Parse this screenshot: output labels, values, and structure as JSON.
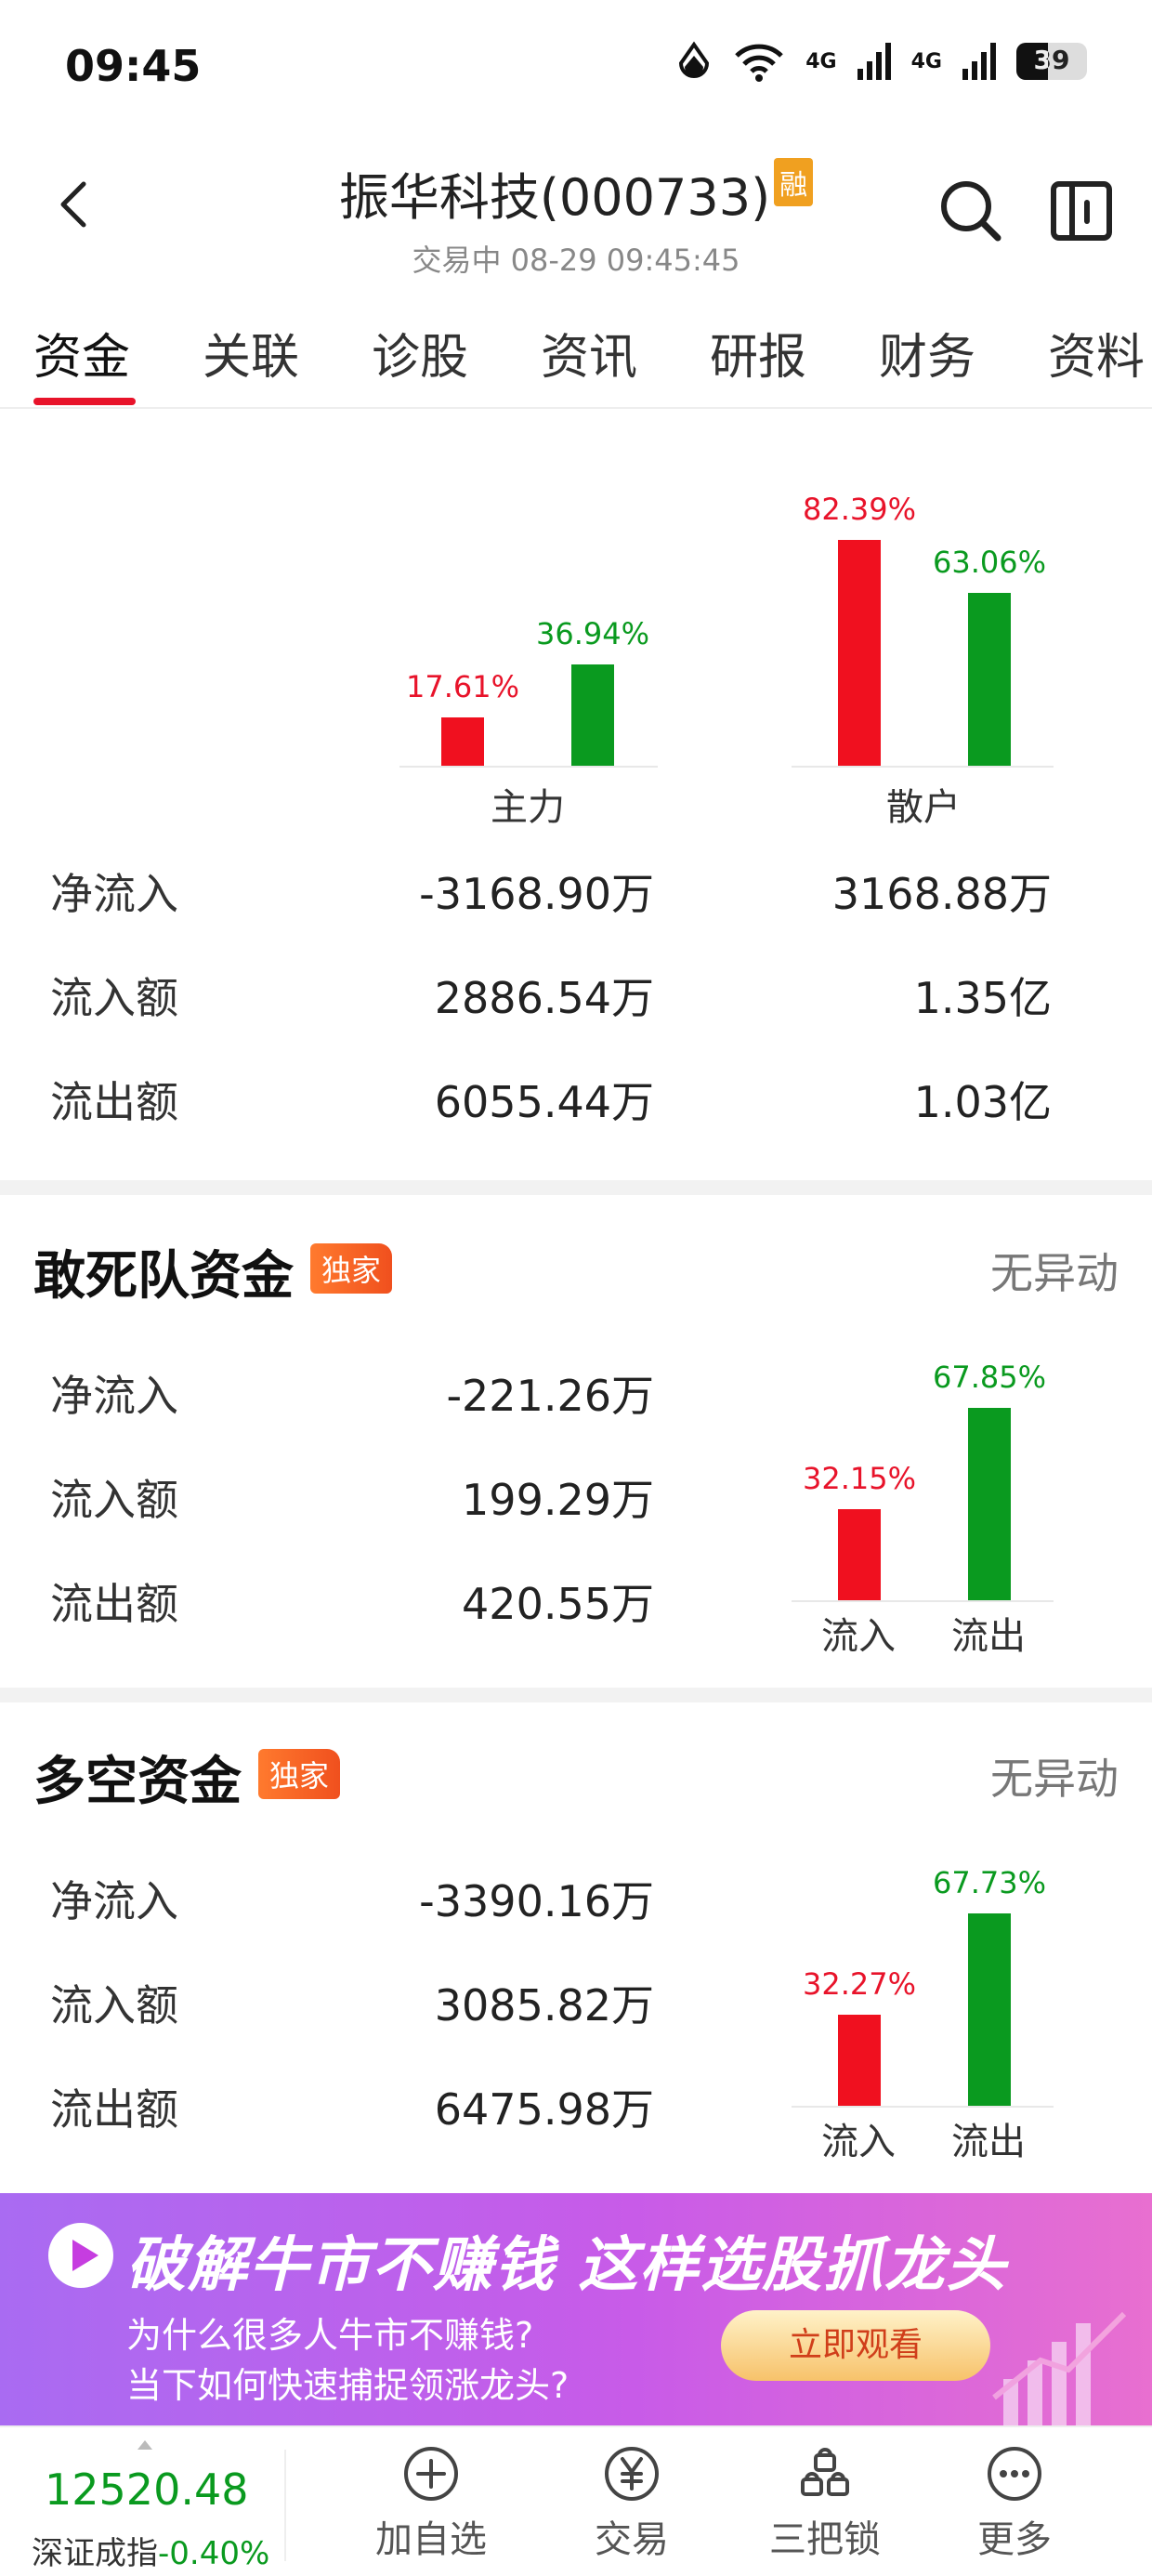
{
  "status_bar": {
    "time": "09:45",
    "network1": "4G",
    "network2": "4G",
    "battery": "39"
  },
  "header": {
    "title": "振华科技(000733)",
    "badge": "融",
    "subtitle": "交易中 08-29 09:45:45"
  },
  "tabs": [
    "资金",
    "关联",
    "诊股",
    "资讯",
    "研报",
    "财务",
    "资料"
  ],
  "main_flow": {
    "chart_data": {
      "type": "bar",
      "categories": [
        "主力",
        "散户"
      ],
      "series": [
        {
          "values": [
            17.61,
            82.39
          ],
          "labels": [
            "17.61%",
            "82.39%"
          ]
        },
        {
          "values": [
            36.94,
            63.06
          ],
          "labels": [
            "36.94%",
            "63.06%"
          ]
        }
      ],
      "unit": "%"
    },
    "rows": [
      {
        "label": "净流入",
        "main": "-3168.90万",
        "retail": "3168.88万"
      },
      {
        "label": "流入额",
        "main": "2886.54万",
        "retail": "1.35亿"
      },
      {
        "label": "流出额",
        "main": "6055.44万",
        "retail": "1.03亿"
      }
    ]
  },
  "dare_fund": {
    "title": "敢死队资金",
    "badge": "独家",
    "status": "无异动",
    "rows": [
      {
        "label": "净流入",
        "value": "-221.26万"
      },
      {
        "label": "流入额",
        "value": "199.29万"
      },
      {
        "label": "流出额",
        "value": "420.55万"
      }
    ],
    "chart_data": {
      "type": "bar",
      "categories": [
        "流入",
        "流出"
      ],
      "values": [
        32.15,
        67.85
      ],
      "labels": [
        "32.15%",
        "67.85%"
      ],
      "unit": "%"
    }
  },
  "longshort_fund": {
    "title": "多空资金",
    "badge": "独家",
    "status": "无异动",
    "rows": [
      {
        "label": "净流入",
        "value": "-3390.16万"
      },
      {
        "label": "流入额",
        "value": "3085.82万"
      },
      {
        "label": "流出额",
        "value": "6475.98万"
      }
    ],
    "chart_data": {
      "type": "bar",
      "categories": [
        "流入",
        "流出"
      ],
      "values": [
        32.27,
        67.73
      ],
      "labels": [
        "32.27%",
        "67.73%"
      ],
      "unit": "%"
    }
  },
  "banner": {
    "headline": "破解牛市不赚钱 这样选股抓龙头",
    "line1": "为什么很多人牛市不赚钱?",
    "line2": "当下如何快速捕捉领涨龙头?",
    "cta": "立即观看"
  },
  "bottom_bar": {
    "index_value": "12520.48",
    "index_name": "深证成指",
    "index_change": "-0.40%",
    "nav": [
      "加自选",
      "交易",
      "三把锁",
      "更多"
    ]
  },
  "colors": {
    "up": "#e8132a",
    "down": "#0a9a1f",
    "accent": "#e8132a"
  }
}
